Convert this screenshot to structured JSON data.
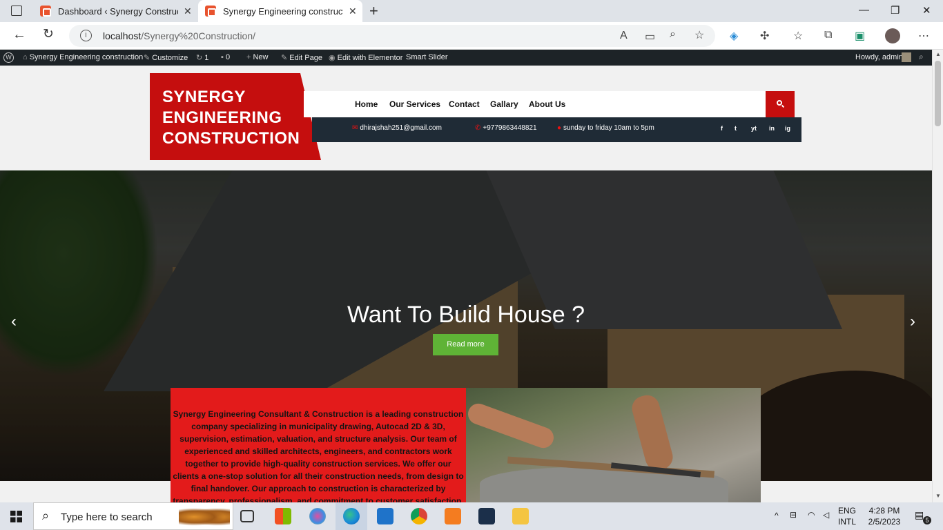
{
  "browser": {
    "tabs": [
      {
        "title": "Dashboard ‹ Synergy Constructio",
        "active": false
      },
      {
        "title": "Synergy Engineering constructio",
        "active": true
      }
    ],
    "new_tab": "+",
    "url_host": "localhost",
    "url_path": "/Synergy%20Construction/"
  },
  "wp_admin_bar": {
    "site_name": "Synergy Engineering construction",
    "customize": "Customize",
    "updates": "1",
    "comments": "0",
    "new": "New",
    "edit_page": "Edit Page",
    "edit_elementor": "Edit with Elementor",
    "smart_slider": "Smart Slider",
    "howdy": "Howdy, admin"
  },
  "header": {
    "logo_lines": [
      "SYNERGY",
      "ENGINEERING",
      "CONSTRUCTION"
    ],
    "nav": [
      "Home",
      "Our Services",
      "Contact",
      "Gallary",
      "About Us"
    ],
    "email": "dhirajshah251@gmail.com",
    "phone": "+9779863448821",
    "hours": "sunday to friday 10am to 5pm",
    "social": [
      "f",
      "t",
      "yt",
      "in",
      "ig"
    ]
  },
  "hero": {
    "title": "Want To Build House ?",
    "button": "Read more"
  },
  "about": {
    "text": "Synergy Engineering Consultant & Construction is a leading construction company specializing in municipality drawing, Autocad 2D & 3D, supervision, estimation, valuation, and structure analysis. Our team of experienced and skilled architects, engineers, and contractors work together to provide high-quality construction services. We offer our clients a one-stop solution for all their construction needs, from design to final handover. Our approach to construction is characterized by transparency, professionalism, and commitment to customer satisfaction. We use the"
  },
  "taskbar": {
    "search_placeholder": "Type here to search",
    "lang_top": "ENG",
    "lang_bottom": "INTL",
    "time": "4:28 PM",
    "date": "2/5/2023",
    "notifications": "5"
  },
  "colors": {
    "brand_red": "#c50e0e",
    "about_red": "#e31b1b",
    "read_more_green": "#5fb336",
    "info_bar": "#1f2b36"
  }
}
